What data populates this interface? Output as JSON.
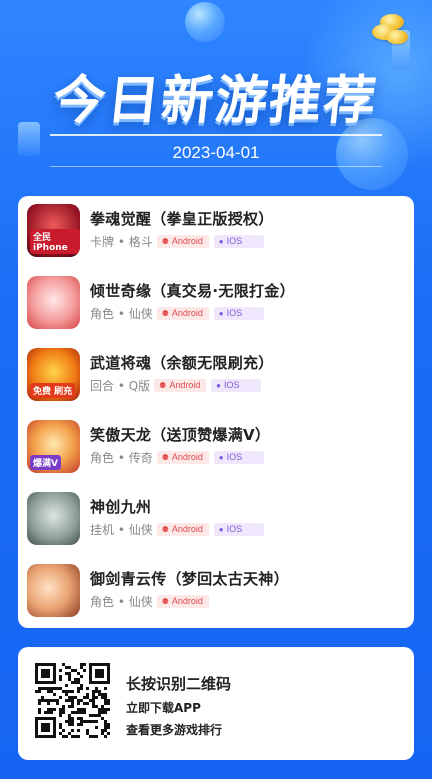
{
  "header": {
    "title": "今日新游推荐",
    "date": "2023-04-01"
  },
  "colors": {
    "background": "#1a6cf5",
    "android_badge": "#e04a4a",
    "ios_badge": "#7d5ad8"
  },
  "platforms": {
    "android": "Android",
    "ios": "IOS"
  },
  "games": [
    {
      "name": "拳魂觉醒（拳皇正版授权）",
      "tags": "卡牌 • 格斗",
      "android": true,
      "ios": true,
      "icon": "game-icon-fighter",
      "icon_badge": "全民iPhone"
    },
    {
      "name": "倾世奇缘（真交易·无限打金）",
      "tags": "角色 • 仙侠",
      "android": true,
      "ios": true,
      "icon": "game-icon-fairy",
      "icon_badge": ""
    },
    {
      "name": "武道将魂（余额无限刷充）",
      "tags": "回合 • Q版",
      "android": true,
      "ios": true,
      "icon": "game-icon-warrior",
      "icon_badge": "免费 刷充"
    },
    {
      "name": "笑傲天龙（送顶赞爆满V）",
      "tags": "角色 • 传奇",
      "android": true,
      "ios": true,
      "icon": "game-icon-dragon",
      "icon_badge": "爆满V"
    },
    {
      "name": "神创九州",
      "tags": "挂机 • 仙侠",
      "android": true,
      "ios": true,
      "icon": "game-icon-calligraphy",
      "icon_badge": ""
    },
    {
      "name": "御剑青云传（梦回太古天神）",
      "tags": "角色 • 仙侠",
      "android": true,
      "ios": false,
      "icon": "game-icon-swordsman",
      "icon_badge": ""
    }
  ],
  "qr_section": {
    "title": "长按识别二维码",
    "line1": "立即下载APP",
    "line2": "查看更多游戏排行"
  }
}
